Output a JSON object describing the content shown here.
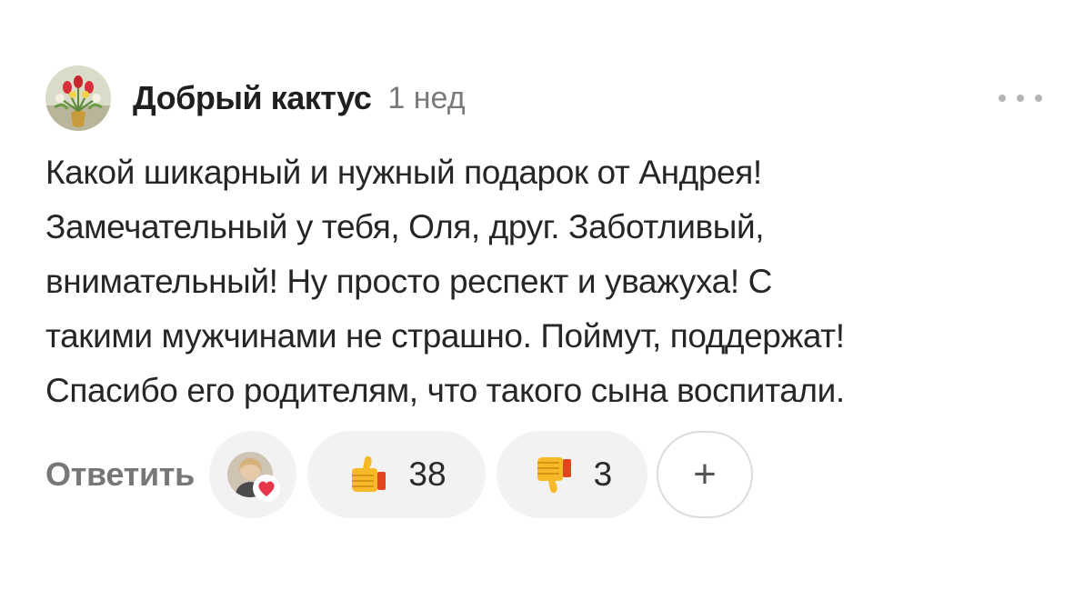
{
  "comment": {
    "author": "Добрый кактус",
    "timestamp": "1 нед",
    "text_lines": [
      "Какой шикарный и нужный подарок от Андрея!",
      "Замечательный у тебя, Оля, друг. Заботливый,",
      "внимательный! Ну просто респект и уважуха! С",
      "такими мужчинами не страшно. Поймут, поддержат!",
      "Спасибо его родителям, что такого сына воспитали."
    ]
  },
  "actions": {
    "reply_label": "Ответить",
    "like_count": "38",
    "dislike_count": "3",
    "add_reaction_symbol": "+"
  },
  "icons": {
    "avatar": "flower-bouquet-avatar",
    "more": "more-dots-icon",
    "reactor": "reactor-avatar-with-heart",
    "like": "thumbs-up-icon",
    "dislike": "thumbs-down-icon",
    "add": "plus-icon"
  },
  "colors": {
    "text": "#262626",
    "muted": "#7a7a7a",
    "pill_bg": "#f2f2f2",
    "heart": "#e8354a",
    "thumb": "#f7b928"
  }
}
